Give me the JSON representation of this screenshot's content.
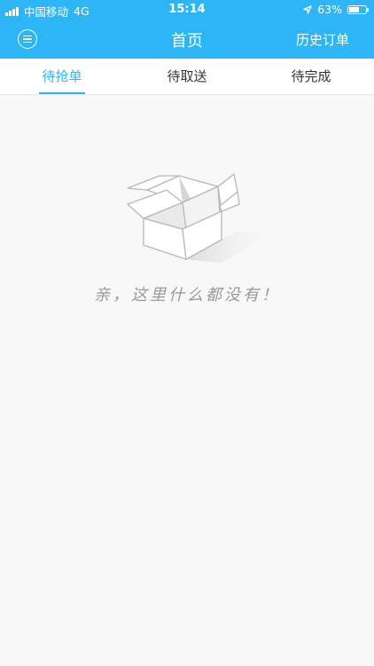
{
  "status_bar": {
    "carrier": "中国移动",
    "network": "4G",
    "time": "15:14",
    "battery": "63%",
    "battery_level": 0.63
  },
  "navbar": {
    "title": "首页",
    "right_action": "历史订单",
    "menu_icon": "menu-circle-icon"
  },
  "tabs": [
    {
      "label": "待抢单",
      "active": true
    },
    {
      "label": "待取送",
      "active": false
    },
    {
      "label": "待完成",
      "active": false
    }
  ],
  "empty_state": {
    "icon": "open-box-icon",
    "message": "亲，这里什么都没有！"
  },
  "colors": {
    "primary": "#2cb6f5",
    "background": "#f8f8f8",
    "tab_text": "#333333"
  }
}
